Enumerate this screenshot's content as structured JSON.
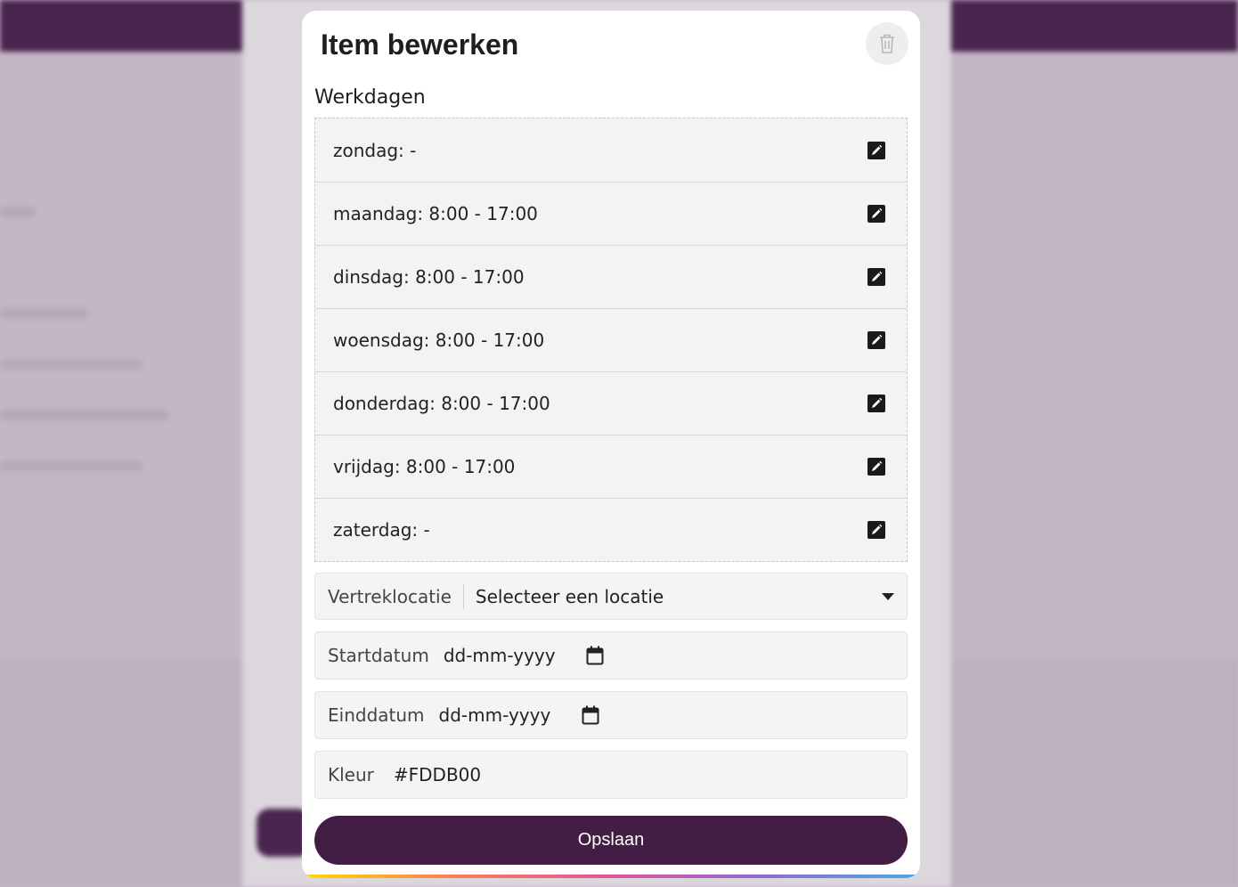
{
  "modal": {
    "title": "Item bewerken",
    "section_label": "Werkdagen",
    "days": [
      "zondag: -",
      "maandag: 8:00 - 17:00",
      "dinsdag: 8:00 - 17:00",
      "woensdag: 8:00 - 17:00",
      "donderdag: 8:00 - 17:00",
      "vrijdag: 8:00 - 17:00",
      "zaterdag: -"
    ],
    "departure": {
      "label": "Vertreklocatie",
      "value": "Selecteer een locatie"
    },
    "start_date": {
      "label": "Startdatum",
      "placeholder": "dd-mm-yyyy"
    },
    "end_date": {
      "label": "Einddatum",
      "placeholder": "dd-mm-yyyy"
    },
    "color": {
      "label": "Kleur",
      "value": "#FDDB00"
    },
    "save_label": "Opslaan"
  },
  "colors": {
    "primary": "#421e45",
    "row_bg": "#f3f3f3"
  },
  "icons": {
    "delete": "trash-icon",
    "edit": "edit-icon",
    "calendar": "calendar-icon",
    "dropdown": "chevron-down-icon"
  }
}
